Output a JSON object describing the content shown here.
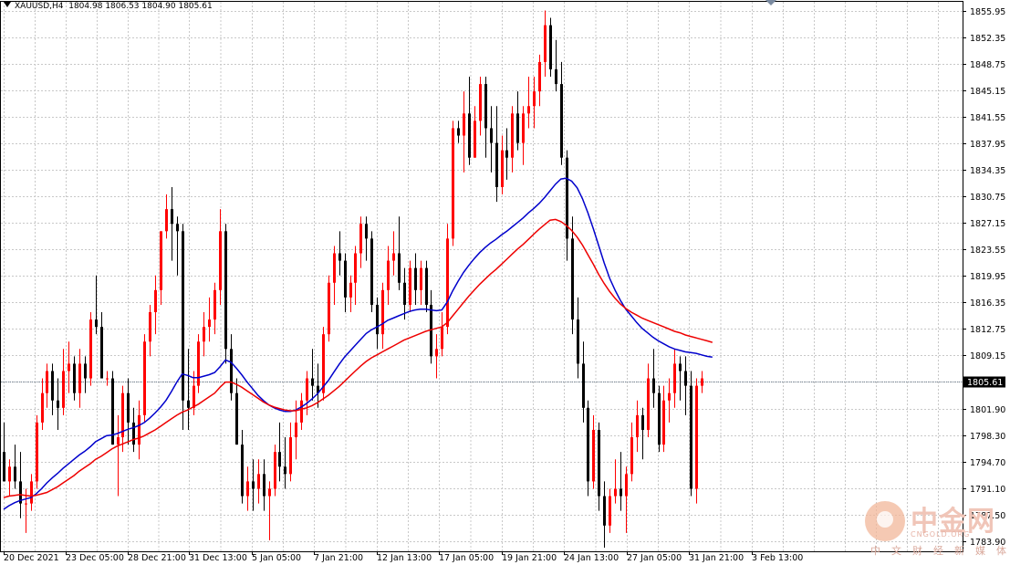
{
  "header": {
    "symbol": "XAUUSD,H4",
    "ohlc": "1804.98 1806.53 1804.90 1805.61"
  },
  "watermark": {
    "brand": "中金网",
    "domain": "CNGOLD.ORG",
    "tagline": "中文财经新媒体"
  },
  "colors": {
    "bull": "#ff0000",
    "bear": "#000000",
    "ma_fast": "#0000cc",
    "ma_slow": "#ee0000",
    "grid": "#c8c8c8",
    "price_line": "#708090"
  },
  "chart_data": {
    "type": "candlestick",
    "symbol": "XAUUSD",
    "timeframe": "H4",
    "ylim": [
      1783.5,
      1857.5
    ],
    "y_ticks": [
      "1855.95",
      "1852.35",
      "1848.75",
      "1845.15",
      "1841.55",
      "1837.95",
      "1834.35",
      "1830.75",
      "1827.15",
      "1823.55",
      "1819.95",
      "1816.35",
      "1812.75",
      "1809.15",
      "1805.55",
      "1801.90",
      "1798.30",
      "1794.70",
      "1791.10",
      "1787.50",
      "1783.90"
    ],
    "x_ticks": [
      "20 Dec 2021",
      "23 Dec 05:00",
      "28 Dec 21:00",
      "31 Dec 13:00",
      "5 Jan 05:00",
      "7 Jan 21:00",
      "12 Jan 13:00",
      "17 Jan 05:00",
      "19 Jan 21:00",
      "24 Jan 13:00",
      "27 Jan 05:00",
      "31 Jan 21:00",
      "3 Feb 13:00"
    ],
    "current_price": "1805.61",
    "grid": true,
    "bar_count": 140,
    "candles": [
      [
        1796,
        1800,
        1794,
        1792
      ],
      [
        1792,
        1795,
        1790,
        1794
      ],
      [
        1794,
        1797,
        1791,
        1792
      ],
      [
        1792,
        1796,
        1787,
        1789
      ],
      [
        1789,
        1791,
        1785,
        1789
      ],
      [
        1789,
        1793,
        1788,
        1792
      ],
      [
        1792,
        1801,
        1791,
        1800
      ],
      [
        1800,
        1806,
        1799,
        1804
      ],
      [
        1804,
        1808,
        1802,
        1807
      ],
      [
        1807,
        1808,
        1801,
        1803
      ],
      [
        1803,
        1806,
        1799,
        1802
      ],
      [
        1802,
        1810,
        1801,
        1807
      ],
      [
        1807,
        1811,
        1804,
        1808
      ],
      [
        1808,
        1809,
        1803,
        1804
      ],
      [
        1804,
        1810,
        1802,
        1808
      ],
      [
        1808,
        1809,
        1804,
        1806
      ],
      [
        1806,
        1815,
        1805,
        1814
      ],
      [
        1814,
        1820,
        1812,
        1813
      ],
      [
        1813,
        1815,
        1806,
        1806
      ],
      [
        1806,
        1807,
        1805,
        1806
      ],
      [
        1806,
        1807,
        1797,
        1797
      ],
      [
        1797,
        1801,
        1790,
        1798
      ],
      [
        1798,
        1805,
        1796,
        1804
      ],
      [
        1804,
        1806,
        1797,
        1800
      ],
      [
        1800,
        1802,
        1796,
        1797
      ],
      [
        1797,
        1803,
        1795,
        1801
      ],
      [
        1801,
        1812,
        1800,
        1811
      ],
      [
        1811,
        1816,
        1809,
        1815
      ],
      [
        1815,
        1820,
        1812,
        1818
      ],
      [
        1818,
        1826,
        1816,
        1826
      ],
      [
        1826,
        1831,
        1825,
        1829
      ],
      [
        1829,
        1832,
        1822,
        1827
      ],
      [
        1827,
        1828,
        1820,
        1826
      ],
      [
        1826,
        1827,
        1799,
        1803
      ],
      [
        1803,
        1810,
        1799,
        1802
      ],
      [
        1802,
        1807,
        1801,
        1805
      ],
      [
        1805,
        1812,
        1804,
        1811
      ],
      [
        1811,
        1815,
        1809,
        1813
      ],
      [
        1813,
        1817,
        1811,
        1814
      ],
      [
        1814,
        1819,
        1812,
        1818
      ],
      [
        1818,
        1829,
        1816,
        1826
      ],
      [
        1826,
        1827,
        1808,
        1810
      ],
      [
        1810,
        1812,
        1803,
        1804
      ],
      [
        1804,
        1806,
        1797,
        1797
      ],
      [
        1797,
        1799,
        1789,
        1790
      ],
      [
        1790,
        1794,
        1788,
        1792
      ],
      [
        1792,
        1795,
        1788,
        1791
      ],
      [
        1791,
        1795,
        1789,
        1793
      ],
      [
        1793,
        1795,
        1788,
        1790
      ],
      [
        1790,
        1792,
        1784,
        1791
      ],
      [
        1791,
        1797,
        1790,
        1796
      ],
      [
        1796,
        1800,
        1792,
        1794
      ],
      [
        1794,
        1798,
        1791,
        1793
      ],
      [
        1793,
        1800,
        1792,
        1798
      ],
      [
        1798,
        1803,
        1795,
        1800
      ],
      [
        1800,
        1804,
        1799,
        1803
      ],
      [
        1803,
        1807,
        1801,
        1806
      ],
      [
        1806,
        1810,
        1803,
        1805
      ],
      [
        1805,
        1808,
        1802,
        1804
      ],
      [
        1804,
        1813,
        1803,
        1812
      ],
      [
        1812,
        1820,
        1811,
        1819
      ],
      [
        1819,
        1824,
        1816,
        1823
      ],
      [
        1823,
        1826,
        1820,
        1822
      ],
      [
        1822,
        1823,
        1815,
        1817
      ],
      [
        1817,
        1820,
        1815,
        1819
      ],
      [
        1819,
        1824,
        1816,
        1823
      ],
      [
        1823,
        1828,
        1821,
        1827
      ],
      [
        1827,
        1828,
        1822,
        1825
      ],
      [
        1825,
        1826,
        1815,
        1816
      ],
      [
        1816,
        1817,
        1810,
        1812
      ],
      [
        1812,
        1819,
        1810,
        1818
      ],
      [
        1818,
        1824,
        1816,
        1822
      ],
      [
        1822,
        1826,
        1820,
        1823
      ],
      [
        1823,
        1828,
        1818,
        1819
      ],
      [
        1819,
        1821,
        1814,
        1816
      ],
      [
        1816,
        1822,
        1815,
        1821
      ],
      [
        1821,
        1823,
        1816,
        1818
      ],
      [
        1818,
        1822,
        1816,
        1821
      ],
      [
        1821,
        1822,
        1815,
        1816
      ],
      [
        1816,
        1818,
        1808,
        1809
      ],
      [
        1809,
        1812,
        1806,
        1810
      ],
      [
        1810,
        1815,
        1809,
        1813
      ],
      [
        1813,
        1827,
        1812,
        1825
      ],
      [
        1825,
        1841,
        1824,
        1840
      ],
      [
        1840,
        1841,
        1838,
        1839
      ],
      [
        1839,
        1845,
        1834,
        1842
      ],
      [
        1842,
        1847,
        1835,
        1836
      ],
      [
        1836,
        1843,
        1836,
        1841
      ],
      [
        1841,
        1847,
        1839,
        1846
      ],
      [
        1846,
        1847,
        1836,
        1840
      ],
      [
        1840,
        1843,
        1834,
        1838
      ],
      [
        1838,
        1843,
        1830,
        1832
      ],
      [
        1832,
        1839,
        1831,
        1837
      ],
      [
        1837,
        1840,
        1833,
        1836
      ],
      [
        1836,
        1843,
        1834,
        1842
      ],
      [
        1842,
        1845,
        1837,
        1838
      ],
      [
        1838,
        1843,
        1835,
        1842
      ],
      [
        1842,
        1847,
        1840,
        1843
      ],
      [
        1843,
        1847,
        1840,
        1845
      ],
      [
        1845,
        1850,
        1843,
        1849
      ],
      [
        1849,
        1856,
        1847,
        1854
      ],
      [
        1854,
        1855,
        1847,
        1848
      ],
      [
        1848,
        1852,
        1845,
        1846
      ],
      [
        1846,
        1849,
        1835,
        1836
      ],
      [
        1836,
        1837,
        1822,
        1825
      ],
      [
        1825,
        1828,
        1812,
        1814
      ],
      [
        1814,
        1817,
        1806,
        1808
      ],
      [
        1808,
        1811,
        1800,
        1802
      ],
      [
        1802,
        1803,
        1790,
        1792
      ],
      [
        1792,
        1801,
        1791,
        1799
      ],
      [
        1799,
        1800,
        1788,
        1790
      ],
      [
        1790,
        1792,
        1783,
        1786
      ],
      [
        1786,
        1791,
        1785,
        1790
      ],
      [
        1790,
        1795,
        1789,
        1791
      ],
      [
        1791,
        1796,
        1788,
        1790
      ],
      [
        1790,
        1794,
        1785,
        1793
      ],
      [
        1793,
        1800,
        1792,
        1798
      ],
      [
        1798,
        1803,
        1796,
        1801
      ],
      [
        1801,
        1802,
        1795,
        1799
      ],
      [
        1799,
        1808,
        1798,
        1806
      ],
      [
        1806,
        1810,
        1802,
        1804
      ],
      [
        1804,
        1805,
        1796,
        1797
      ],
      [
        1797,
        1805,
        1796,
        1803
      ],
      [
        1803,
        1806,
        1800,
        1804
      ],
      [
        1804,
        1810,
        1802,
        1808
      ],
      [
        1808,
        1809,
        1803,
        1807
      ],
      [
        1807,
        1809,
        1801,
        1805
      ],
      [
        1805,
        1807,
        1790,
        1791
      ],
      [
        1791,
        1806,
        1789,
        1805
      ],
      [
        1805,
        1807,
        1804,
        1806
      ]
    ],
    "series": [
      {
        "name": "",
        "color": "#0000cc",
        "values": [
          1788.2,
          1788.7,
          1789.1,
          1789.4,
          1789.6,
          1789.8,
          1790.3,
          1791.0,
          1791.8,
          1792.5,
          1793.1,
          1793.8,
          1794.4,
          1795.0,
          1795.6,
          1796.1,
          1796.7,
          1797.4,
          1797.8,
          1798.2,
          1798.3,
          1798.5,
          1798.8,
          1799.1,
          1799.3,
          1799.6,
          1800.0,
          1800.6,
          1801.3,
          1802.1,
          1803.0,
          1804.2,
          1805.5,
          1806.6,
          1806.4,
          1806.1,
          1806.1,
          1806.3,
          1806.5,
          1806.8,
          1807.6,
          1808.5,
          1808.2,
          1807.4,
          1806.5,
          1805.5,
          1804.6,
          1803.7,
          1803.0,
          1802.4,
          1802.0,
          1801.7,
          1801.5,
          1801.5,
          1801.7,
          1802.1,
          1802.6,
          1803.2,
          1803.9,
          1804.8,
          1805.7,
          1806.8,
          1807.9,
          1808.9,
          1809.7,
          1810.5,
          1811.3,
          1812.1,
          1812.6,
          1813.0,
          1813.4,
          1813.9,
          1814.2,
          1814.5,
          1814.8,
          1815.1,
          1815.3,
          1815.4,
          1815.4,
          1815.3,
          1815.2,
          1815.3,
          1816.4,
          1817.9,
          1819.2,
          1820.4,
          1821.4,
          1822.3,
          1823.1,
          1823.8,
          1824.4,
          1824.9,
          1825.5,
          1826.0,
          1826.6,
          1827.2,
          1827.8,
          1828.5,
          1829.1,
          1829.8,
          1830.6,
          1831.5,
          1832.4,
          1833.1,
          1833.2,
          1832.8,
          1831.9,
          1830.4,
          1828.5,
          1826.3,
          1824.0,
          1821.7,
          1819.6,
          1818.0,
          1816.6,
          1815.4,
          1814.5,
          1813.6,
          1812.8,
          1812.2,
          1811.6,
          1811.1,
          1810.7,
          1810.3,
          1810.0,
          1809.8,
          1809.6,
          1809.5,
          1809.4,
          1809.2,
          1809.0,
          1808.9
        ]
      },
      {
        "name": "",
        "color": "#ee0000",
        "values": [
          1789.8,
          1790.0,
          1790.1,
          1790.2,
          1790.1,
          1790.0,
          1790.1,
          1790.3,
          1790.5,
          1790.9,
          1791.3,
          1791.8,
          1792.3,
          1792.8,
          1793.4,
          1793.9,
          1794.4,
          1795.0,
          1795.4,
          1795.9,
          1796.4,
          1796.8,
          1797.1,
          1797.4,
          1797.7,
          1797.9,
          1798.2,
          1798.6,
          1799.0,
          1799.5,
          1800.0,
          1800.5,
          1801.0,
          1801.4,
          1801.7,
          1802.1,
          1802.5,
          1803.0,
          1803.5,
          1804.0,
          1804.8,
          1805.5,
          1805.5,
          1805.2,
          1804.8,
          1804.3,
          1803.8,
          1803.3,
          1802.8,
          1802.4,
          1802.1,
          1801.9,
          1801.7,
          1801.6,
          1801.6,
          1801.8,
          1802.0,
          1802.3,
          1802.7,
          1803.2,
          1803.7,
          1804.3,
          1804.9,
          1805.6,
          1806.3,
          1807.0,
          1807.7,
          1808.3,
          1808.8,
          1809.2,
          1809.6,
          1810.0,
          1810.4,
          1810.8,
          1811.2,
          1811.5,
          1811.8,
          1812.1,
          1812.4,
          1812.6,
          1812.8,
          1813.0,
          1813.6,
          1814.5,
          1815.4,
          1816.3,
          1817.2,
          1818.0,
          1818.8,
          1819.5,
          1820.2,
          1820.8,
          1821.5,
          1822.2,
          1822.9,
          1823.6,
          1824.2,
          1824.9,
          1825.6,
          1826.3,
          1826.9,
          1827.5,
          1827.6,
          1827.3,
          1826.8,
          1826.1,
          1825.2,
          1824.1,
          1822.8,
          1821.5,
          1820.1,
          1818.9,
          1817.8,
          1816.9,
          1816.1,
          1815.5,
          1815.0,
          1814.6,
          1814.2,
          1813.9,
          1813.6,
          1813.3,
          1813.0,
          1812.7,
          1812.4,
          1812.2,
          1811.9,
          1811.7,
          1811.5,
          1811.3,
          1811.1,
          1810.9
        ]
      }
    ]
  }
}
